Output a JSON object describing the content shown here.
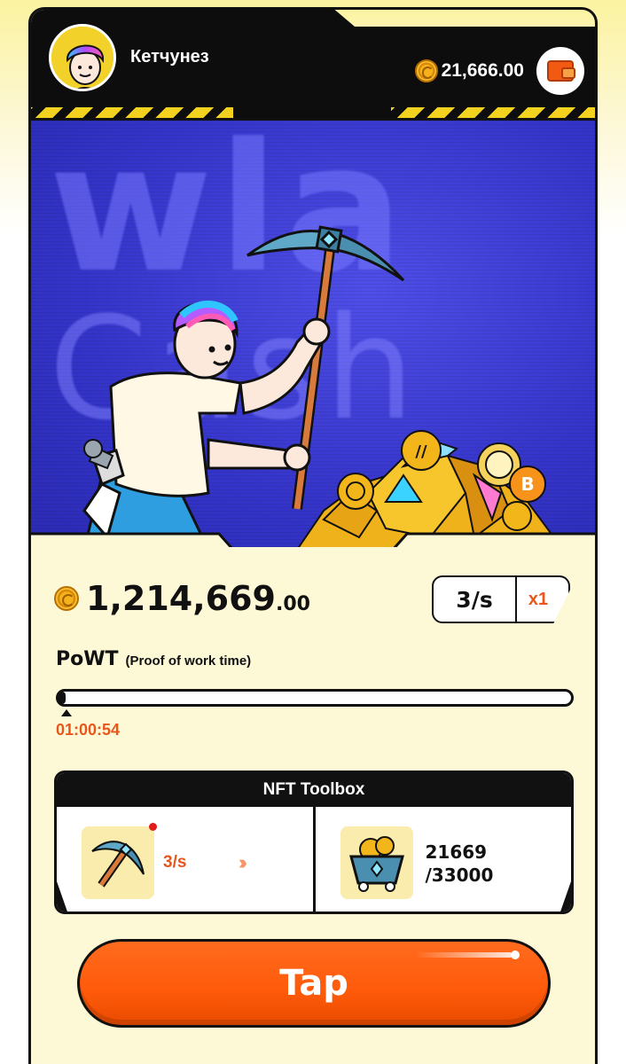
{
  "header": {
    "username": "Кетчунез",
    "balance": "21,666.00",
    "avatar_icon": "user-avatar",
    "wallet_icon": "wallet-icon"
  },
  "hero": {
    "background_text_line1": "wla",
    "background_text_line2": "Cash"
  },
  "stats": {
    "mined_whole": "1,214,669",
    "mined_decimal": ".00",
    "rate": "3/s",
    "multiplier": "x1"
  },
  "powt": {
    "title": "PoWT",
    "subtitle": "(Proof of work time)",
    "timer": "01:00:54",
    "progress_fraction": 0.0
  },
  "toolbox": {
    "title": "NFT Toolbox",
    "tool_rate": "3/s",
    "tool_icon": "pickaxe-icon",
    "cart_icon": "mine-cart-icon",
    "storage_current": "21669",
    "storage_max": "/33000"
  },
  "tap": {
    "label": "Tap"
  },
  "colors": {
    "accent_orange": "#ff5a0a",
    "hero_blue": "#3434c9",
    "panel_cream": "#fdf8d6",
    "hazard_yellow": "#f2d21e"
  }
}
